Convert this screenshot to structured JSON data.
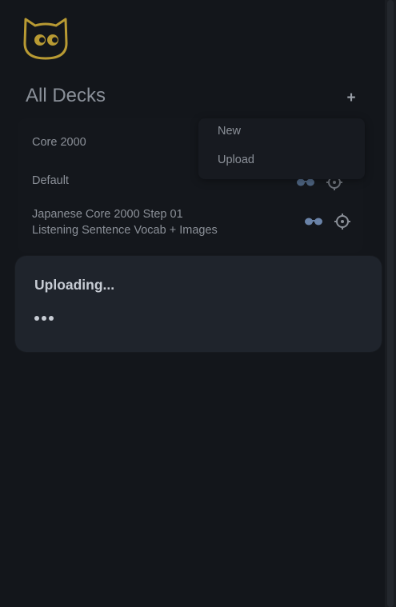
{
  "header": {
    "title": "All Decks",
    "add_label": "+"
  },
  "decks": [
    {
      "name_line1": "Core 2000",
      "name_line2": ""
    },
    {
      "name_line1": "Default",
      "name_line2": ""
    },
    {
      "name_line1": "Japanese Core 2000 Step 01",
      "name_line2": "Listening Sentence Vocab + Images"
    }
  ],
  "menu": {
    "items": [
      "New",
      "Upload"
    ]
  },
  "dialog": {
    "title": "Uploading..."
  },
  "icons": {
    "logo": "owl-logo-icon",
    "study": "glasses-icon",
    "settings": "gear-icon"
  },
  "colors": {
    "background": "#13161b",
    "logo": "#b89a33",
    "glasses": "#6a83a8",
    "text": "#8b9098",
    "dialog": "#1f242c"
  }
}
